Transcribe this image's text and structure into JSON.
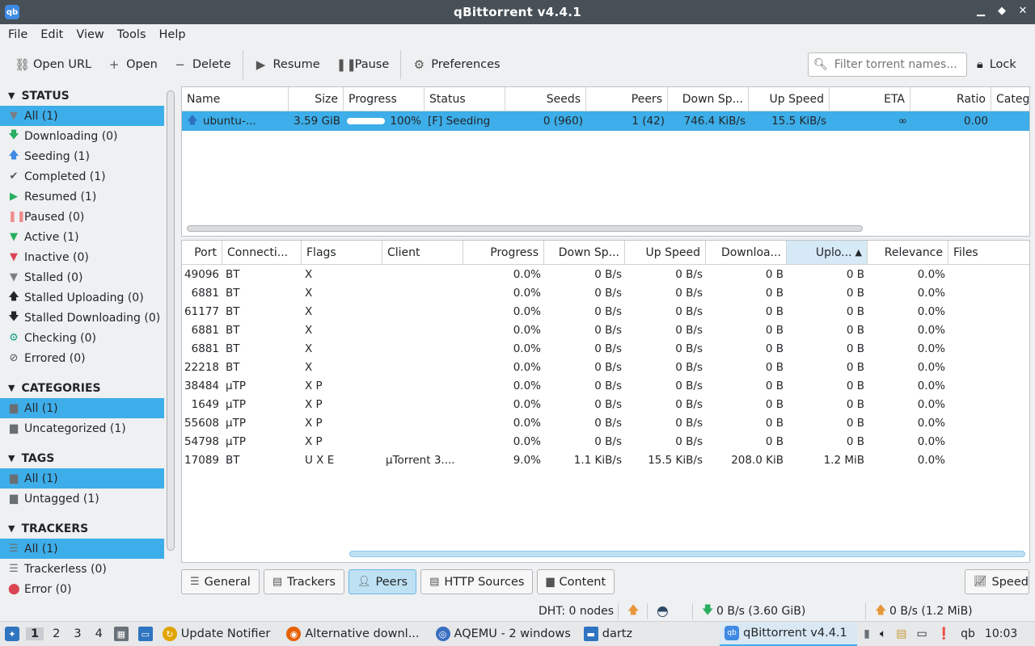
{
  "window": {
    "title": "qBittorrent v4.4.1",
    "app_icon": "qb"
  },
  "menu": [
    "File",
    "Edit",
    "View",
    "Tools",
    "Help"
  ],
  "toolbar": {
    "open_url": "Open URL",
    "open": "Open",
    "delete": "Delete",
    "resume": "Resume",
    "pause": "Pause",
    "preferences": "Preferences"
  },
  "search": {
    "placeholder": "Filter torrent names..."
  },
  "lock_label": "Lock",
  "sidebar": {
    "status_header": "STATUS",
    "status": [
      {
        "label": "All (1)",
        "icon": "filter-icon",
        "selected": true
      },
      {
        "label": "Downloading (0)",
        "icon": "arrow-down-icon"
      },
      {
        "label": "Seeding (1)",
        "icon": "arrow-up-icon"
      },
      {
        "label": "Completed (1)",
        "icon": "check-icon"
      },
      {
        "label": "Resumed (1)",
        "icon": "play-icon"
      },
      {
        "label": "Paused (0)",
        "icon": "pause-icon"
      },
      {
        "label": "Active (1)",
        "icon": "filter-icon"
      },
      {
        "label": "Inactive (0)",
        "icon": "filter-icon"
      },
      {
        "label": "Stalled (0)",
        "icon": "filter-icon"
      },
      {
        "label": "Stalled Uploading (0)",
        "icon": "arrow-up-icon"
      },
      {
        "label": "Stalled Downloading (0)",
        "icon": "arrow-down-icon"
      },
      {
        "label": "Checking (0)",
        "icon": "gear-icon"
      },
      {
        "label": "Errored (0)",
        "icon": "error-circle-icon"
      }
    ],
    "categories_header": "CATEGORIES",
    "categories": [
      {
        "label": "All (1)",
        "selected": true
      },
      {
        "label": "Uncategorized (1)"
      }
    ],
    "tags_header": "TAGS",
    "tags": [
      {
        "label": "All (1)",
        "selected": true
      },
      {
        "label": "Untagged (1)"
      }
    ],
    "trackers_header": "TRACKERS",
    "trackers": [
      {
        "label": "All (1)",
        "selected": true
      },
      {
        "label": "Trackerless (0)"
      },
      {
        "label": "Error (0)"
      }
    ]
  },
  "torrent_table": {
    "columns": [
      "Name",
      "Size",
      "Progress",
      "Status",
      "Seeds",
      "Peers",
      "Down Sp...",
      "Up Speed",
      "ETA",
      "Ratio",
      "Catego"
    ],
    "rows": [
      {
        "name": "ubuntu-...",
        "size": "3.59 GiB",
        "progress": "100%",
        "progress_fraction": 1.0,
        "status": "[F] Seeding",
        "seeds": "0 (960)",
        "peers": "1 (42)",
        "down": "746.4 KiB/s",
        "up": "15.5 KiB/s",
        "eta": "∞",
        "ratio": "0.00"
      }
    ]
  },
  "peers_table": {
    "columns": [
      "Port",
      "Connecti...",
      "Flags",
      "Client",
      "Progress",
      "Down Sp...",
      "Up Speed",
      "Downloa...",
      "Uplo...",
      "Relevance",
      "Files"
    ],
    "rows": [
      [
        "49096",
        "BT",
        "X",
        "",
        "0.0%",
        "0 B/s",
        "0 B/s",
        "0 B",
        "0 B",
        "0.0%",
        ""
      ],
      [
        "6881",
        "BT",
        "X",
        "",
        "0.0%",
        "0 B/s",
        "0 B/s",
        "0 B",
        "0 B",
        "0.0%",
        ""
      ],
      [
        "61177",
        "BT",
        "X",
        "",
        "0.0%",
        "0 B/s",
        "0 B/s",
        "0 B",
        "0 B",
        "0.0%",
        ""
      ],
      [
        "6881",
        "BT",
        "X",
        "",
        "0.0%",
        "0 B/s",
        "0 B/s",
        "0 B",
        "0 B",
        "0.0%",
        ""
      ],
      [
        "6881",
        "BT",
        "X",
        "",
        "0.0%",
        "0 B/s",
        "0 B/s",
        "0 B",
        "0 B",
        "0.0%",
        ""
      ],
      [
        "22218",
        "BT",
        "X",
        "",
        "0.0%",
        "0 B/s",
        "0 B/s",
        "0 B",
        "0 B",
        "0.0%",
        ""
      ],
      [
        "38484",
        "µTP",
        "X P",
        "",
        "0.0%",
        "0 B/s",
        "0 B/s",
        "0 B",
        "0 B",
        "0.0%",
        ""
      ],
      [
        "1649",
        "µTP",
        "X P",
        "",
        "0.0%",
        "0 B/s",
        "0 B/s",
        "0 B",
        "0 B",
        "0.0%",
        ""
      ],
      [
        "55608",
        "µTP",
        "X P",
        "",
        "0.0%",
        "0 B/s",
        "0 B/s",
        "0 B",
        "0 B",
        "0.0%",
        ""
      ],
      [
        "54798",
        "µTP",
        "X P",
        "",
        "0.0%",
        "0 B/s",
        "0 B/s",
        "0 B",
        "0 B",
        "0.0%",
        ""
      ],
      [
        "17089",
        "BT",
        "U X E",
        "µTorrent 3....",
        "9.0%",
        "1.1 KiB/s",
        "15.5 KiB/s",
        "208.0 KiB",
        "1.2 MiB",
        "0.0%",
        ""
      ]
    ]
  },
  "tabs": [
    "General",
    "Trackers",
    "Peers",
    "HTTP Sources",
    "Content"
  ],
  "selected_tab": "Peers",
  "speed_button": "Speed",
  "statusbar": {
    "dht": "DHT: 0 nodes",
    "download": "0 B/s (3.60 GiB)",
    "upload": "0 B/s (1.2 MiB)"
  },
  "taskbar": {
    "desktops": [
      "1",
      "2",
      "3",
      "4"
    ],
    "windows": [
      "Update Notifier",
      "Alternative downl...",
      "AQEMU - 2 windows",
      "dartz",
      "qBittorrent v4.4.1"
    ],
    "active_window": "qBittorrent v4.4.1",
    "tray_label": "qb",
    "clock": "10:03"
  },
  "colors": {
    "selection": "#3daee9",
    "titlebar": "#475057",
    "seed_arrow": "#3f8ae2",
    "down_arrow": "#27ae60",
    "pause": "#ef8a8a",
    "error": "#da4453"
  }
}
